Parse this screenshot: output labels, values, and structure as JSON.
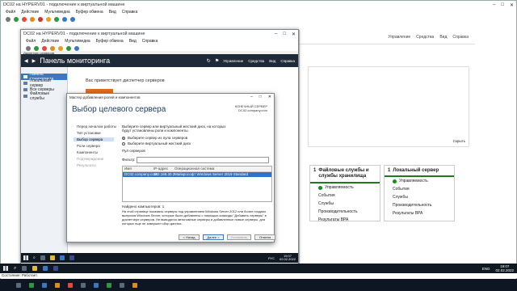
{
  "outer": {
    "title": "DC02 на HYPERV01 - подключение к виртуальной машине",
    "menu": [
      "Файл",
      "Действие",
      "Мультимедиа",
      "Буфер обмена",
      "Вид",
      "Справка"
    ],
    "header_links": [
      "Управление",
      "Средства",
      "Вид",
      "Справка"
    ],
    "hide_label": "Скрыть",
    "tiles": [
      {
        "num": "1",
        "title": "Файловые службы и службы хранилища",
        "items": [
          "Управляемость",
          "События",
          "Службы",
          "Производительность",
          "Результаты BPA"
        ]
      },
      {
        "num": "1",
        "title": "Локальный сервер",
        "items": [
          "Управляемость",
          "События",
          "Службы",
          "Производительность",
          "Результаты BPA"
        ]
      }
    ],
    "tray_lang": "ENG",
    "tray_time": "19:07",
    "tray_date": "02.02.2022",
    "status": "Состояние: Работает"
  },
  "vm": {
    "title": "DC02 на HYPERV01 - подключение к виртуальной машине",
    "menu": [
      "Файл",
      "Действие",
      "Мультимедиа",
      "Буфер обмена",
      "Вид",
      "Справка"
    ],
    "sm_breadcrumb": "Диспетчер серверов",
    "sm_title": "Панель мониторинга",
    "sm_menu": [
      "Управление",
      "Средства",
      "Вид",
      "Справка"
    ],
    "sidebar": [
      "Панель мониторинга",
      "Локальный сервер",
      "Все серверы",
      "Файловые службы"
    ],
    "welcome": "Вас приветствует диспетчер серверов",
    "tray_lang": "РУС",
    "tray_time": "19:07",
    "tray_date": "02.02.2022",
    "status": "Состояние: Работает"
  },
  "wizard": {
    "title": "Мастер добавления ролей и компонентов",
    "heading": "Выбор целевого сервера",
    "dest_label": "КОНЕЧНЫЙ СЕРВЕР",
    "dest_value": "DC02.company.com",
    "steps": [
      "Перед началом работы",
      "Тип установки",
      "Выбор сервера",
      "Роли сервера",
      "Компоненты",
      "Подтверждение",
      "Результаты"
    ],
    "intro": "Выберите сервер или виртуальный жесткий диск, на которых будут установлены роли и компоненты.",
    "radio1": "Выберите сервер из пула серверов",
    "radio2": "Выберите виртуальный жесткий диск",
    "pool_label": "Пул серверов",
    "filter_label": "Фильтр:",
    "columns": [
      "Имя",
      "IP-адрес",
      "Операционная система"
    ],
    "row": {
      "name": "DC02.company.com",
      "ip": "192.168.30.2",
      "os": "Майкрософт Windows Server 2019 Standard"
    },
    "found": "Найдено компьютеров: 1",
    "description": "На этой странице показаны серверы под управлением Windows Server 2012 или более поздних выпусков Windows Server, которые были добавлены с помощью команды \"Добавить серверы\" в диспетчере серверов. Не выводятся автономные серверы и добавленные новые серверы, для которых еще не завершен сбор данных.",
    "buttons": {
      "back": "< Назад",
      "next": "Далее >",
      "install": "Установить",
      "cancel": "Отмена"
    }
  }
}
